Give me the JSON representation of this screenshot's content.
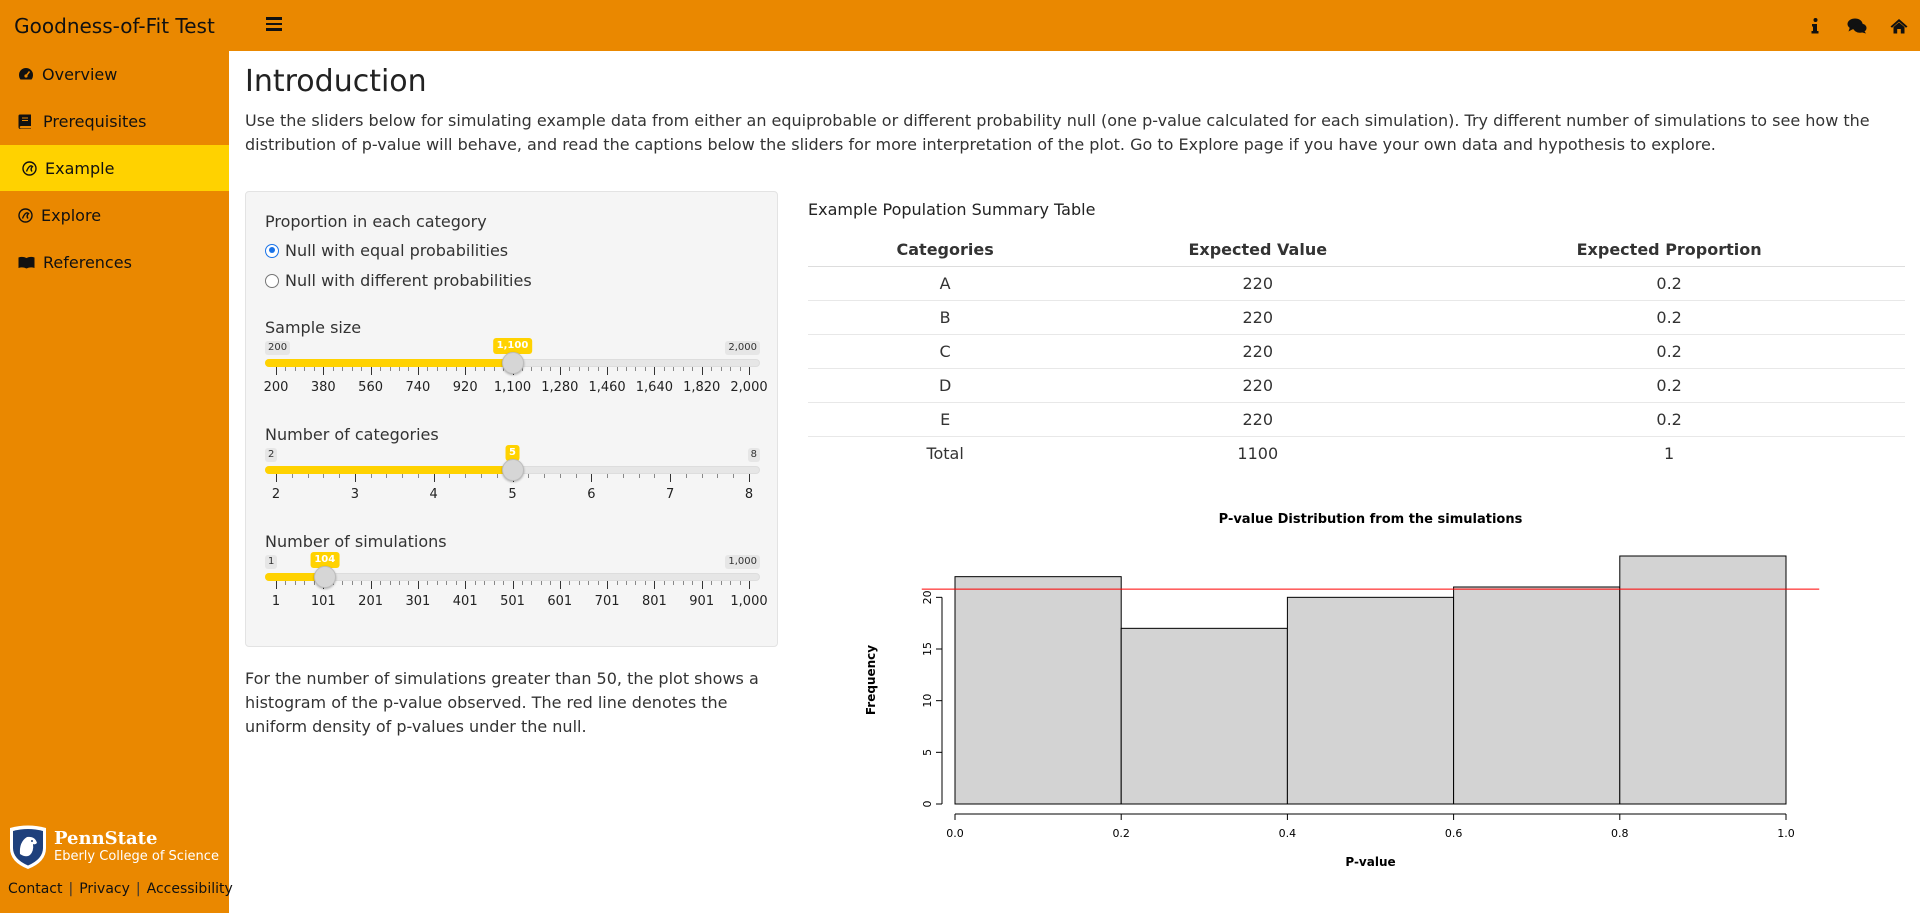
{
  "app": {
    "title": "Goodness-of-Fit Test",
    "header_icons": [
      "info-icon",
      "comments-icon",
      "home-icon"
    ],
    "colors": {
      "header": "#ea8800",
      "active": "#ffd200",
      "radio": "#1a73e8",
      "ref_line": "#ff0000"
    }
  },
  "sidebar": {
    "items": [
      {
        "label": "Overview",
        "icon": "gauge-icon"
      },
      {
        "label": "Prerequisites",
        "icon": "book-icon"
      },
      {
        "label": "Example",
        "icon": "paw-icon",
        "active": true
      },
      {
        "label": "Explore",
        "icon": "paw-icon"
      },
      {
        "label": "References",
        "icon": "open-book-icon"
      }
    ],
    "logo": {
      "name": "PennState",
      "college": "Eberly College of Science"
    },
    "footer_links": [
      "Contact",
      "Privacy",
      "Accessibility"
    ]
  },
  "main": {
    "title": "Introduction",
    "intro": "Use the sliders below for simulating example data from either an equiprobable or different probability null (one p-value calculated for each simulation). Try different number of simulations to see how the distribution of p-value will behave, and read the captions below the sliders for more interpretation of the plot. Go to Explore page if you have your own data and hypothesis to explore.",
    "controls": {
      "proportion_label": "Proportion in each category",
      "radio_options": [
        "Null with equal probabilities",
        "Null with different probabilities"
      ],
      "radio_selected": 0,
      "sliders": [
        {
          "label": "Sample size",
          "min_label": "200",
          "max_label": "2,000",
          "value_label": "1,100",
          "fraction": 0.5,
          "ticks": [
            "200",
            "380",
            "560",
            "740",
            "920",
            "1,100",
            "1,280",
            "1,460",
            "1,640",
            "1,820",
            "2,000"
          ],
          "minor": 4
        },
        {
          "label": "Number of categories",
          "min_label": "2",
          "max_label": "8",
          "value_label": "5",
          "fraction": 0.5,
          "ticks": [
            "2",
            "3",
            "4",
            "5",
            "6",
            "7",
            "8"
          ],
          "minor": 4
        },
        {
          "label": "Number of simulations",
          "min_label": "1",
          "max_label": "1,000",
          "value_label": "104",
          "fraction": 0.1031,
          "ticks": [
            "1",
            "101",
            "201",
            "301",
            "401",
            "501",
            "601",
            "701",
            "801",
            "901",
            "1,000"
          ],
          "minor": 4
        }
      ]
    },
    "caption": "For the number of simulations greater than 50, the plot shows a histogram of the p-value observed. The red line denotes the uniform density of p-values under the null.",
    "table": {
      "title": "Example Population Summary Table",
      "headers": [
        "Categories",
        "Expected Value",
        "Expected Proportion"
      ],
      "rows": [
        [
          "A",
          "220",
          "0.2"
        ],
        [
          "B",
          "220",
          "0.2"
        ],
        [
          "C",
          "220",
          "0.2"
        ],
        [
          "D",
          "220",
          "0.2"
        ],
        [
          "E",
          "220",
          "0.2"
        ],
        [
          "Total",
          "1100",
          "1"
        ]
      ]
    },
    "chart_data": {
      "type": "bar",
      "title": "P-value Distribution from the simulations",
      "xlabel": "P-value",
      "ylabel": "Frequency",
      "bins": [
        [
          0.0,
          0.2
        ],
        [
          0.2,
          0.4
        ],
        [
          0.4,
          0.6
        ],
        [
          0.6,
          0.8
        ],
        [
          0.8,
          1.0
        ]
      ],
      "values": [
        22,
        17,
        20,
        21,
        24
      ],
      "reference_line": 20.8,
      "xlim": [
        0,
        1
      ],
      "ylim": [
        0,
        24
      ],
      "xticks": [
        "0.0",
        "0.2",
        "0.4",
        "0.6",
        "0.8",
        "1.0"
      ],
      "yticks": [
        "0",
        "5",
        "10",
        "15",
        "20"
      ],
      "grid": false
    }
  }
}
